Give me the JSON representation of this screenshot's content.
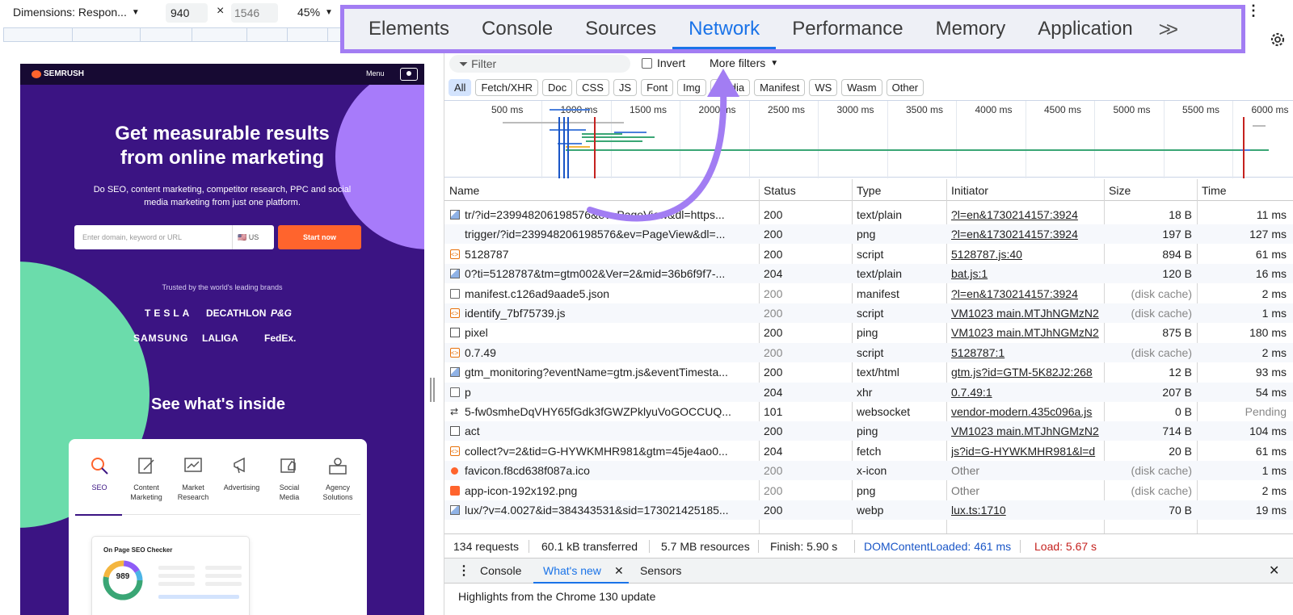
{
  "device_toolbar": {
    "dimensions_label": "Dimensions: Respon...",
    "width": "940",
    "height": "1546",
    "zoom": "45%"
  },
  "devtools_tabs": [
    {
      "label": "Elements"
    },
    {
      "label": "Console"
    },
    {
      "label": "Sources"
    },
    {
      "label": "Network",
      "active": true
    },
    {
      "label": "Performance"
    },
    {
      "label": "Memory"
    },
    {
      "label": "Application"
    }
  ],
  "site": {
    "logo": "SEMRUSH",
    "menu": "Menu",
    "hero_title_1": "Get measurable results",
    "hero_title_2": "from online marketing",
    "hero_sub_1": "Do SEO, content marketing, competitor research, PPC and social",
    "hero_sub_2": "media marketing from just one platform.",
    "input_placeholder": "Enter domain, keyword or URL",
    "country": "🇺🇸 US",
    "cta": "Start now",
    "trusted": "Trusted by the world's leading brands",
    "brands": [
      "TESLA",
      "DECATHLON",
      "P&G",
      "SAMSUNG",
      "LALIGA",
      "FedEx."
    ],
    "see_inside": "See what's inside",
    "categories": [
      {
        "label_1": "SEO",
        "label_2": ""
      },
      {
        "label_1": "Content",
        "label_2": "Marketing"
      },
      {
        "label_1": "Market",
        "label_2": "Research"
      },
      {
        "label_1": "Advertising",
        "label_2": ""
      },
      {
        "label_1": "Social",
        "label_2": "Media"
      },
      {
        "label_1": "Agency",
        "label_2": "Solutions"
      }
    ],
    "seo_checker_title": "On Page SEO Checker",
    "seo_checker_score": "989"
  },
  "network": {
    "filter_placeholder": "Filter",
    "invert_label": "Invert",
    "more_filters": "More filters",
    "type_filters": [
      "All",
      "Fetch/XHR",
      "Doc",
      "CSS",
      "JS",
      "Font",
      "Img",
      "Media",
      "Manifest",
      "WS",
      "Wasm",
      "Other"
    ],
    "timeline_ticks": [
      "500 ms",
      "1000 ms",
      "1500 ms",
      "2000 ms",
      "2500 ms",
      "3000 ms",
      "3500 ms",
      "4000 ms",
      "4500 ms",
      "5000 ms",
      "5500 ms",
      "6000 ms"
    ],
    "columns": [
      "Name",
      "Status",
      "Type",
      "Initiator",
      "Size",
      "Time"
    ],
    "rows": [
      {
        "icon": "image",
        "name": "tr/?id=239948206198576&ev=PageView&dl=https...",
        "status": "200",
        "type": "text/plain",
        "initiator": "?l=en&1730214157:3924",
        "size": "18 B",
        "time": "11 ms"
      },
      {
        "icon": "none",
        "name": "trigger/?id=239948206198576&ev=PageView&dl=...",
        "status": "200",
        "type": "png",
        "initiator": "?l=en&1730214157:3924",
        "size": "197 B",
        "time": "127 ms"
      },
      {
        "icon": "script",
        "name": "5128787",
        "status": "200",
        "type": "script",
        "initiator": "5128787.js:40",
        "size": "894 B",
        "time": "61 ms"
      },
      {
        "icon": "image",
        "name": "0?ti=5128787&tm=gtm002&Ver=2&mid=36b6f9f7-...",
        "status": "204",
        "type": "text/plain",
        "initiator": "bat.js:1",
        "size": "120 B",
        "time": "16 ms"
      },
      {
        "icon": "doc",
        "name": "manifest.c126ad9aade5.json",
        "status": "200",
        "status_dim": true,
        "type": "manifest",
        "initiator": "?l=en&1730214157:3924",
        "size": "(disk cache)",
        "size_dim": true,
        "time": "2 ms"
      },
      {
        "icon": "script",
        "name": "identify_7bf75739.js",
        "status": "200",
        "status_dim": true,
        "type": "script",
        "initiator": "VM1023 main.MTJhNGMzN2",
        "size": "(disk cache)",
        "size_dim": true,
        "time": "1 ms"
      },
      {
        "icon": "box",
        "name": "pixel",
        "status": "200",
        "type": "ping",
        "initiator": "VM1023 main.MTJhNGMzN2",
        "size": "875 B",
        "time": "180 ms"
      },
      {
        "icon": "script",
        "name": "0.7.49",
        "status": "200",
        "status_dim": true,
        "type": "script",
        "initiator": "5128787:1",
        "size": "(disk cache)",
        "size_dim": true,
        "time": "2 ms"
      },
      {
        "icon": "image",
        "name": "gtm_monitoring?eventName=gtm.js&eventTimesta...",
        "status": "200",
        "type": "text/html",
        "initiator": "gtm.js?id=GTM-5K82J2:268",
        "size": "12 B",
        "time": "93 ms"
      },
      {
        "icon": "doc",
        "name": "p",
        "status": "204",
        "type": "xhr",
        "initiator": "0.7.49:1",
        "size": "207 B",
        "time": "54 ms"
      },
      {
        "icon": "ws",
        "name": "5-fw0smheDqVHY65fGdk3fGWZPklyuVoGOCCUQ...",
        "status": "101",
        "type": "websocket",
        "initiator": "vendor-modern.435c096a.js",
        "size": "0 B",
        "time": "Pending",
        "time_dim": true
      },
      {
        "icon": "box",
        "name": "act",
        "status": "200",
        "type": "ping",
        "initiator": "VM1023 main.MTJhNGMzN2",
        "size": "714 B",
        "time": "104 ms"
      },
      {
        "icon": "script",
        "name": "collect?v=2&tid=G-HYWKMHR981&gtm=45je4ao0...",
        "status": "204",
        "type": "fetch",
        "initiator": "js?id=G-HYWKMHR981&l=d",
        "size": "20 B",
        "time": "61 ms"
      },
      {
        "icon": "favicon",
        "name": "favicon.f8cd638f087a.ico",
        "status": "200",
        "status_dim": true,
        "type": "x-icon",
        "initiator": "Other",
        "initiator_plain": true,
        "size": "(disk cache)",
        "size_dim": true,
        "time": "1 ms"
      },
      {
        "icon": "app",
        "name": "app-icon-192x192.png",
        "status": "200",
        "status_dim": true,
        "type": "png",
        "initiator": "Other",
        "initiator_plain": true,
        "size": "(disk cache)",
        "size_dim": true,
        "time": "2 ms"
      },
      {
        "icon": "image",
        "name": "lux/?v=4.0027&id=384343531&sid=173021425185...",
        "status": "200",
        "type": "webp",
        "initiator": "lux.ts:1710",
        "size": "70 B",
        "time": "19 ms"
      }
    ],
    "summary": {
      "requests": "134 requests",
      "transferred": "60.1 kB transferred",
      "resources": "5.7 MB resources",
      "finish": "Finish: 5.90 s",
      "dcl": "DOMContentLoaded: 461 ms",
      "load": "Load: 5.67 s"
    },
    "colors": {
      "dcl": "#1a56c7",
      "load": "#c5221f",
      "accent": "#1a73e8",
      "highlight": "#a27df3"
    }
  },
  "drawer": {
    "tabs": [
      "Console",
      "What's new",
      "Sensors"
    ],
    "active_tab": "What's new",
    "body": "Highlights from the Chrome 130 update"
  }
}
